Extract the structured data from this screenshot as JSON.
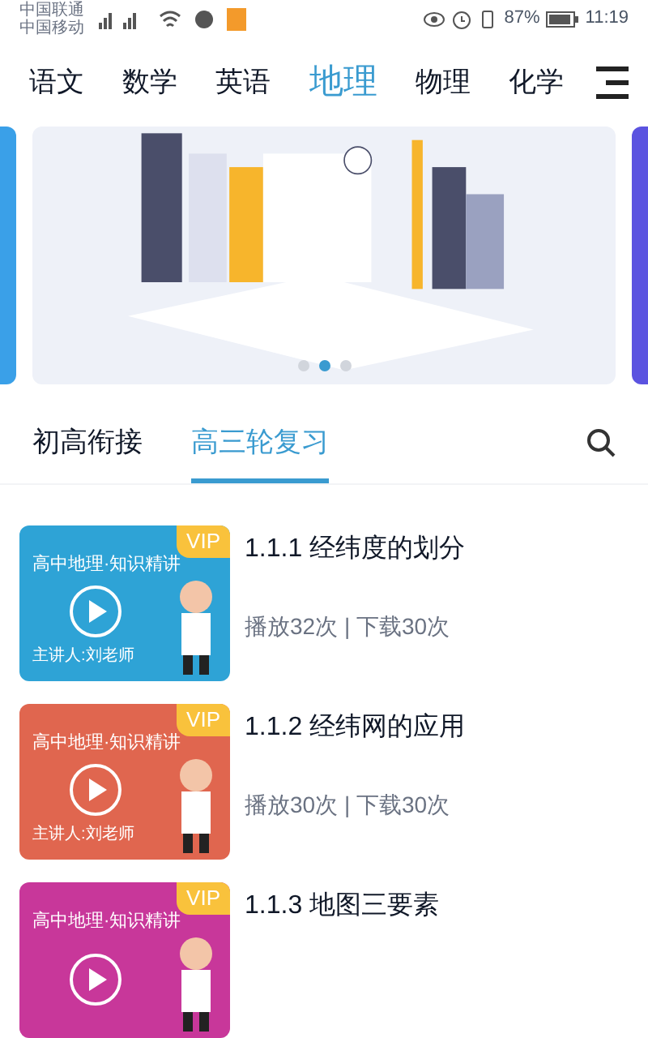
{
  "status_bar": {
    "carriers": [
      "中国联通",
      "中国移动"
    ],
    "battery": "87%",
    "time": "11:19"
  },
  "subject_tabs": [
    {
      "label": "语文",
      "selected": false
    },
    {
      "label": "数学",
      "selected": false
    },
    {
      "label": "英语",
      "selected": false
    },
    {
      "label": "地理",
      "selected": true
    },
    {
      "label": "物理",
      "selected": false
    },
    {
      "label": "化学",
      "selected": false
    }
  ],
  "banner": {
    "dots": [
      {
        "selected": false
      },
      {
        "selected": true
      },
      {
        "selected": false
      }
    ]
  },
  "section_tabs": [
    {
      "label": "初高衔接",
      "selected": false
    },
    {
      "label": "高三轮复习",
      "selected": true
    }
  ],
  "lessons": [
    {
      "title": "1.1.1 经纬度的划分",
      "stats": "播放32次 | 下载30次",
      "thumb_title": "高中地理·知识精讲",
      "thumb_lecturer": "主讲人:刘老师",
      "badge": "VIP",
      "color": "#2ea3d6"
    },
    {
      "title": "1.1.2 经纬网的应用",
      "stats": "播放30次 | 下载30次",
      "thumb_title": "高中地理·知识精讲",
      "thumb_lecturer": "主讲人:刘老师",
      "badge": "VIP",
      "color": "#e0664f"
    },
    {
      "title": "1.1.3 地图三要素",
      "thumb_title": "高中地理·知识精讲",
      "badge": "VIP",
      "color": "#c8379a"
    }
  ]
}
